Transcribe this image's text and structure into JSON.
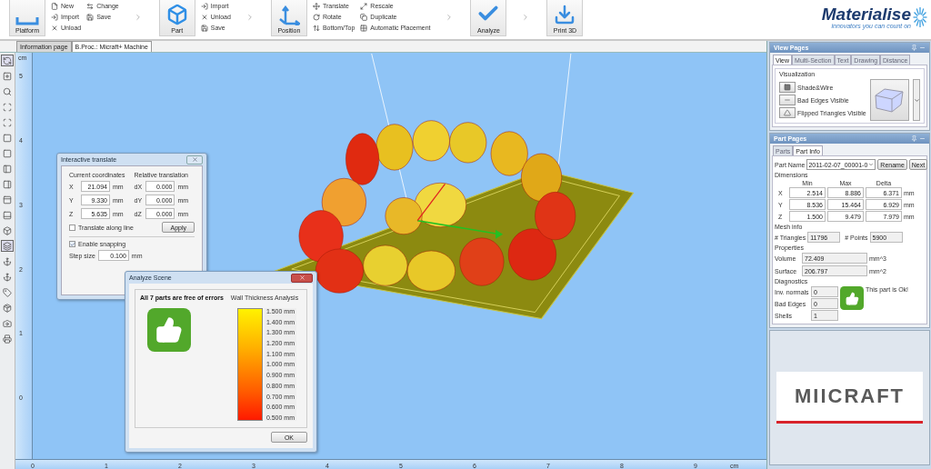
{
  "toolbar": {
    "groups": [
      {
        "label": "Platform",
        "columns": [
          [
            {
              "label": "New"
            },
            {
              "label": "Import"
            },
            {
              "label": "Unload"
            }
          ],
          [
            {
              "label": "Change"
            },
            {
              "label": "Save"
            }
          ]
        ]
      },
      {
        "label": "Part",
        "columns": [
          [
            {
              "label": "Import"
            },
            {
              "label": "Unload"
            },
            {
              "label": "Save"
            }
          ]
        ]
      },
      {
        "label": "Position",
        "columns": [
          [
            {
              "label": "Translate"
            },
            {
              "label": "Rotate"
            },
            {
              "label": "Bottom/Top"
            }
          ],
          [
            {
              "label": "Rescale"
            },
            {
              "label": "Duplicate"
            },
            {
              "label": "Automatic Placement"
            }
          ]
        ]
      },
      {
        "label": "Analyze"
      },
      {
        "label": "Print 3D"
      }
    ],
    "logo": {
      "name": "Materialise",
      "tagline": "innovators you can count on"
    }
  },
  "document_tabs": [
    {
      "label": "Information page",
      "selected": false
    },
    {
      "label": "B.Proc.: Micraft+ Machine",
      "selected": true
    }
  ],
  "rulers": {
    "vertical": {
      "unit": "cm",
      "labels": [
        "5",
        "4",
        "3",
        "2",
        "1",
        "0"
      ]
    },
    "horizontal": {
      "labels": [
        "0",
        "1",
        "2",
        "3",
        "4",
        "5",
        "6",
        "7",
        "8",
        "9"
      ],
      "unit": "cm"
    }
  },
  "translate_dialog": {
    "title": "Interactive translate",
    "current": {
      "heading": "Current coordinates",
      "rows": [
        {
          "axis": "X",
          "value": "21.094",
          "unit": "mm"
        },
        {
          "axis": "Y",
          "value": "9.330",
          "unit": "mm"
        },
        {
          "axis": "Z",
          "value": "5.635",
          "unit": "mm"
        }
      ]
    },
    "relative": {
      "heading": "Relative translation",
      "rows": [
        {
          "axis": "dX",
          "value": "0.000",
          "unit": "mm"
        },
        {
          "axis": "dY",
          "value": "0.000",
          "unit": "mm"
        },
        {
          "axis": "dZ",
          "value": "0.000",
          "unit": "mm"
        }
      ]
    },
    "along_line": {
      "label": "Translate along line",
      "checked": false
    },
    "apply": "Apply",
    "snapping": {
      "label": "Enable snapping",
      "checked": true
    },
    "step": {
      "label": "Step size",
      "value": "0.100",
      "unit": "mm"
    }
  },
  "analyze_dialog": {
    "title": "Analyze Scene",
    "message": "All 7 parts are free of errors",
    "legend_title": "Wall Thickness Analysis",
    "legend": [
      "1.500 mm",
      "1.400 mm",
      "1.300 mm",
      "1.200 mm",
      "1.100 mm",
      "1.000 mm",
      "0.900 mm",
      "0.800 mm",
      "0.700 mm",
      "0.600 mm",
      "0.500 mm"
    ],
    "ok": "OK"
  },
  "view_pages": {
    "title": "View Pages",
    "tabs": [
      {
        "label": "View",
        "selected": true
      },
      {
        "label": "Multi-Section",
        "selected": false
      },
      {
        "label": "Text",
        "selected": false
      },
      {
        "label": "Drawing",
        "selected": false
      },
      {
        "label": "Distance",
        "selected": false
      }
    ],
    "group": "Visualization",
    "options": [
      "Shade&Wire",
      "Bad Edges Visible",
      "Flipped Triangles Visible"
    ]
  },
  "part_pages": {
    "title": "Part Pages",
    "tabs": [
      {
        "label": "Parts",
        "selected": false
      },
      {
        "label": "Part Info",
        "selected": true
      }
    ],
    "name_label": "Part Name",
    "name_value": "2011-02-07_00001-0",
    "buttons": [
      "Rename",
      "Next"
    ],
    "dimensions": {
      "title": "Dimensions",
      "columns": [
        "Min",
        "Max",
        "Delta"
      ],
      "rows": [
        {
          "axis": "X",
          "values": [
            "2.514",
            "8.886",
            "6.371"
          ],
          "unit": "mm"
        },
        {
          "axis": "Y",
          "values": [
            "8.536",
            "15.464",
            "6.929"
          ],
          "unit": "mm"
        },
        {
          "axis": "Z",
          "values": [
            "1.500",
            "9.479",
            "7.979"
          ],
          "unit": "mm"
        }
      ]
    },
    "mesh": {
      "title": "Mesh info",
      "fields": [
        {
          "label": "# Triangles",
          "value": "11796"
        },
        {
          "label": "# Points",
          "value": "5900"
        }
      ]
    },
    "properties": {
      "title": "Properties",
      "rows": [
        {
          "label": "Volume",
          "value": "72.409",
          "unit": "mm^3"
        },
        {
          "label": "Surface",
          "value": "206.797",
          "unit": "mm^2"
        }
      ]
    },
    "diagnostics": {
      "title": "Diagnostics",
      "rows": [
        {
          "label": "Inv. normals",
          "value": "0"
        },
        {
          "label": "Bad Edges",
          "value": "0"
        },
        {
          "label": "Shells",
          "value": "1"
        }
      ],
      "status": "This part is Ok!"
    }
  },
  "brand_logo": "MIICRAFT"
}
